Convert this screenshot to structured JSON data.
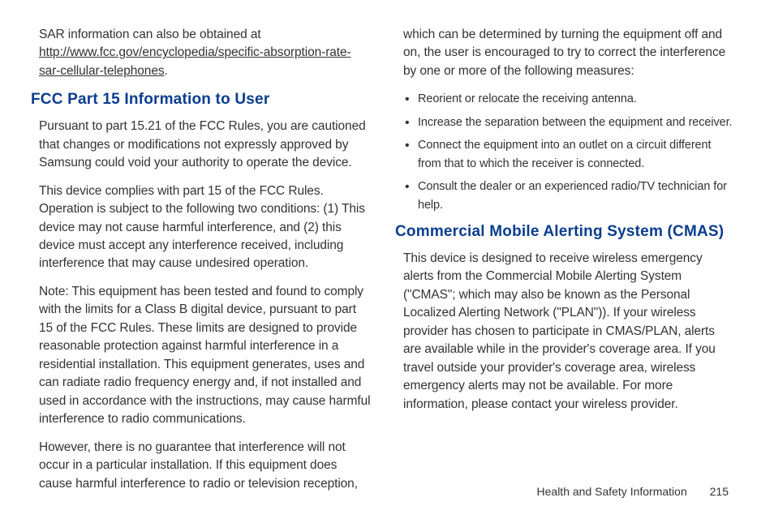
{
  "left": {
    "intro_text_before_link": "SAR information can also be obtained at ",
    "link": "http://www.fcc.gov/encyclopedia/specific-absorption-rate-sar-cellular-telephones",
    "intro_text_after_link": ".",
    "heading": "FCC Part 15 Information to User",
    "p1": "Pursuant to part 15.21 of the FCC Rules, you are cautioned that changes or modifications not expressly approved by Samsung could void your authority to operate the device.",
    "p2": "This device complies with part 15 of the FCC Rules. Operation is subject to the following two conditions: (1) This device may not cause harmful interference, and (2) this device must accept any interference received, including interference that may cause undesired operation.",
    "p3": "Note: This equipment has been tested and found to comply with the limits for a Class B digital device, pursuant to part 15 of the FCC Rules. These limits are designed to provide reasonable protection against harmful interference in a residential installation. This equipment generates, uses and can radiate radio frequency energy and, if not installed and used in accordance with the instructions, may cause harmful interference to radio communications.",
    "p4": "However, there is no guarantee that interference will not occur in a particular installation. If this equipment does cause harmful interference to radio or television reception,"
  },
  "right": {
    "cont": "which can be determined by turning the equipment off and on, the user is encouraged to try to correct the interference by one or more of the following measures:",
    "bullets": [
      "Reorient or relocate the receiving antenna.",
      "Increase the separation between the equipment and receiver.",
      "Connect the equipment into an outlet on a circuit different from that to which the receiver is connected.",
      "Consult the dealer or an experienced radio/TV technician for help."
    ],
    "heading": "Commercial Mobile Alerting System (CMAS)",
    "p1": "This device is designed to receive wireless emergency alerts from the Commercial Mobile Alerting System (\"CMAS\"; which may also be known as the Personal Localized Alerting Network (\"PLAN\")). If your wireless provider has chosen to participate in CMAS/PLAN, alerts are available while in the provider's coverage area. If you travel outside your provider's coverage area, wireless emergency alerts may not be available. For more information, please contact your wireless provider."
  },
  "footer": {
    "section": "Health and Safety Information",
    "page": "215"
  }
}
